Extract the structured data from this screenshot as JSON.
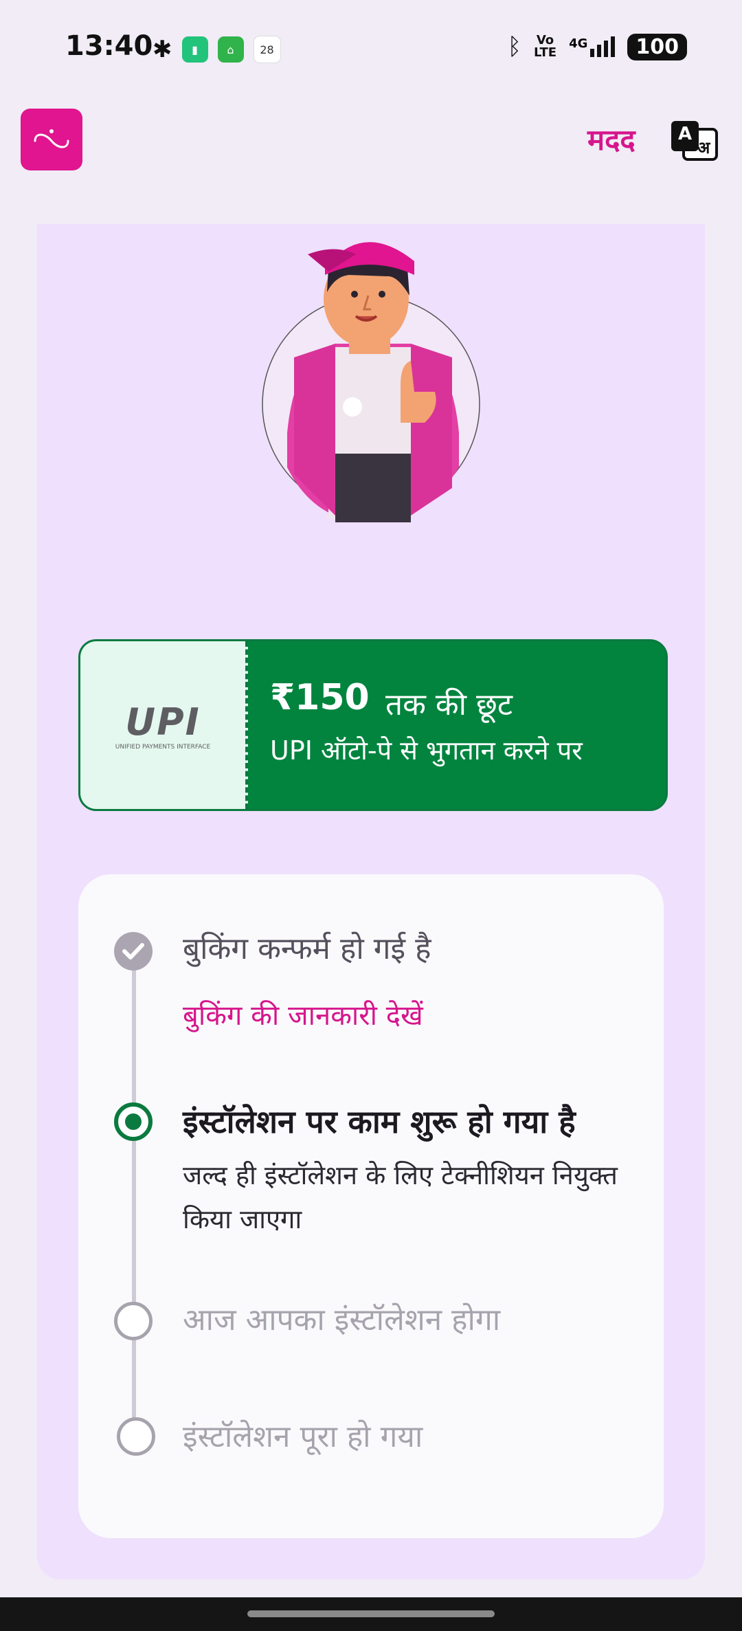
{
  "status_bar": {
    "time": "13:40",
    "calendar_day": "28",
    "network": "4G",
    "volte_top": "Vo",
    "volte_bottom": "LTE",
    "battery": "100"
  },
  "header": {
    "help_label": "मदद",
    "language_icon_a": "A",
    "language_icon_b": "अ"
  },
  "offer": {
    "logo_text": "UPI",
    "logo_subtext": "UNIFIED PAYMENTS INTERFACE",
    "amount": "₹150",
    "title": "तक की छूट",
    "subtitle": "UPI ऑटो-पे से भुगतान करने पर"
  },
  "timeline": {
    "step1": {
      "title": "बुकिंग कन्फर्म हो गई है",
      "link": "बुकिंग की जानकारी देखें",
      "status": "completed"
    },
    "step2": {
      "title": "इंस्टॉलेशन पर काम शुरू हो गया है",
      "description": "जल्द ही इंस्टॉलेशन के लिए टेक्नीशियन नियुक्त किया जाएगा",
      "status": "active"
    },
    "step3": {
      "title": "आज आपका इंस्टॉलेशन होगा",
      "status": "pending"
    },
    "step4": {
      "title": "इंस्टॉलेशन पूरा हो गया",
      "status": "pending"
    }
  },
  "colors": {
    "brand": "#e0158f",
    "success": "#02843f",
    "background": "#f1ecf6",
    "panel": "#efe0fd"
  }
}
